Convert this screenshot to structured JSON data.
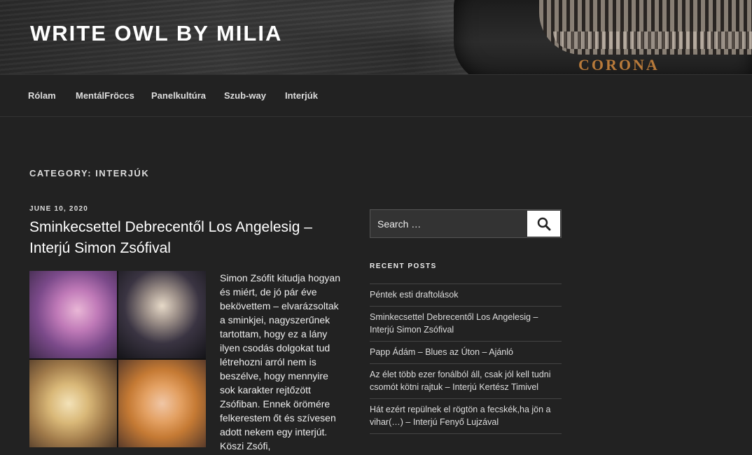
{
  "header": {
    "site_title": "WRITE OWL BY MILIA",
    "brand_text": "CORONA"
  },
  "nav": {
    "items": [
      "Rólam",
      "MentálFröccs",
      "Panelkultúra",
      "Szub-way",
      "Interjúk"
    ]
  },
  "archive": {
    "category_title": "CATEGORY: INTERJÚK"
  },
  "post": {
    "date": "JUNE 10, 2020",
    "title": "Sminkecsettel Debrecentől Los Angelesig – Interjú Simon Zsófival",
    "excerpt": "Simon Zsófit kitudja hogyan és miért, de jó pár éve bekövettem – elvarázsoltak a sminkjei, nagyszerűnek tartottam, hogy ez a lány ilyen csodás dolgokat tud létrehozni arról nem is beszélve, hogy mennyire sok karakter rejtőzött Zsófiban. Ennek örömére felkerestem őt és szívesen adott nekem egy interjút. Köszi Zsófi,"
  },
  "sidebar": {
    "search_placeholder": "Search …",
    "recent_title": "RECENT POSTS",
    "recent_posts": [
      "Péntek esti draftolások",
      "Sminkecsettel Debrecentől Los Angelesig – Interjú Simon Zsófival",
      "Papp Ádám – Blues az Úton – Ajánló",
      "Az élet több ezer fonálból áll, csak jól kell tudni csomót kötni rajtuk – Interjú Kertész Timivel",
      "Hát ezért repülnek el rögtön a fecskék,ha jön a vihar(…) – Interjú Fenyő Lujzával"
    ]
  },
  "colors": {
    "background": "#222222",
    "text": "#dddddd",
    "title": "#ffffff",
    "button": "#ffffff"
  },
  "icons": {
    "search_button": "search-icon"
  }
}
